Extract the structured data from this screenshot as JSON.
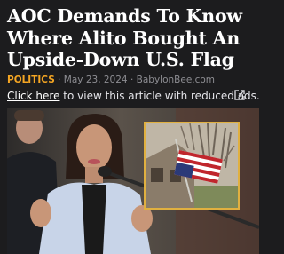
{
  "article": {
    "headline_lines": [
      "AOC Demands To Know",
      "Where Alito Bought An",
      "Upside-Down U.S. Flag"
    ],
    "category": "POLITICS",
    "separator": "·",
    "date": "May 23, 2024",
    "source": "BabylonBee.com"
  },
  "reader_banner": {
    "link_text": "Click here",
    "rest_text": " to view this article with reduced ads.",
    "icon": "external-link-icon"
  },
  "images": {
    "main_photo": "woman-speaking-at-microphone",
    "inset_photo": "upside-down-us-flag-on-house"
  },
  "colors": {
    "background": "#1c1c1e",
    "category_accent": "#f5a623",
    "inset_border": "#e0b040",
    "flag_red": "#c0262d",
    "flag_blue": "#2b3a78"
  }
}
